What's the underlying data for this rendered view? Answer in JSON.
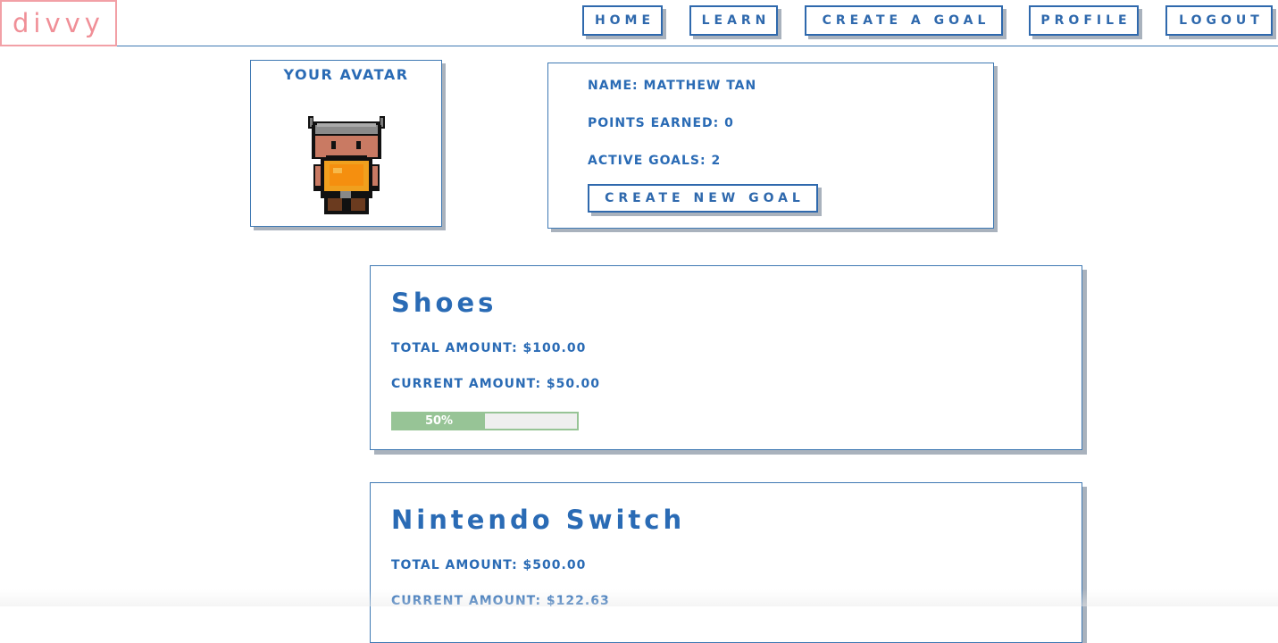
{
  "header": {
    "logo": "divvy",
    "nav": {
      "home": "HOME",
      "learn": "LEARN",
      "create_goal": "CREATE A GOAL",
      "profile": "PROFILE",
      "logout": "LOGOUT"
    }
  },
  "avatar": {
    "title": "YOUR AVATAR",
    "character": "viking-warrior-sprite"
  },
  "profile": {
    "name": "NAME: MATTHEW TAN",
    "points": "POINTS EARNED: 0",
    "active_goals": "ACTIVE GOALS: 2",
    "create_new_goal": "CREATE NEW GOAL"
  },
  "goals": [
    {
      "title": "Shoes",
      "total": "TOTAL AMOUNT: $100.00",
      "current": "CURRENT AMOUNT: $50.00",
      "progress_label": "50%",
      "progress_fraction": 0.5
    },
    {
      "title": "Nintendo Switch",
      "total": "TOTAL AMOUNT: $500.00",
      "current": "CURRENT AMOUNT: $122.63"
    }
  ],
  "colors": {
    "brand_blue": "#2a6bb5",
    "logo_pink": "#f08f97",
    "progress_green": "#97c496",
    "shadow_grey": "#a9b2bd"
  }
}
